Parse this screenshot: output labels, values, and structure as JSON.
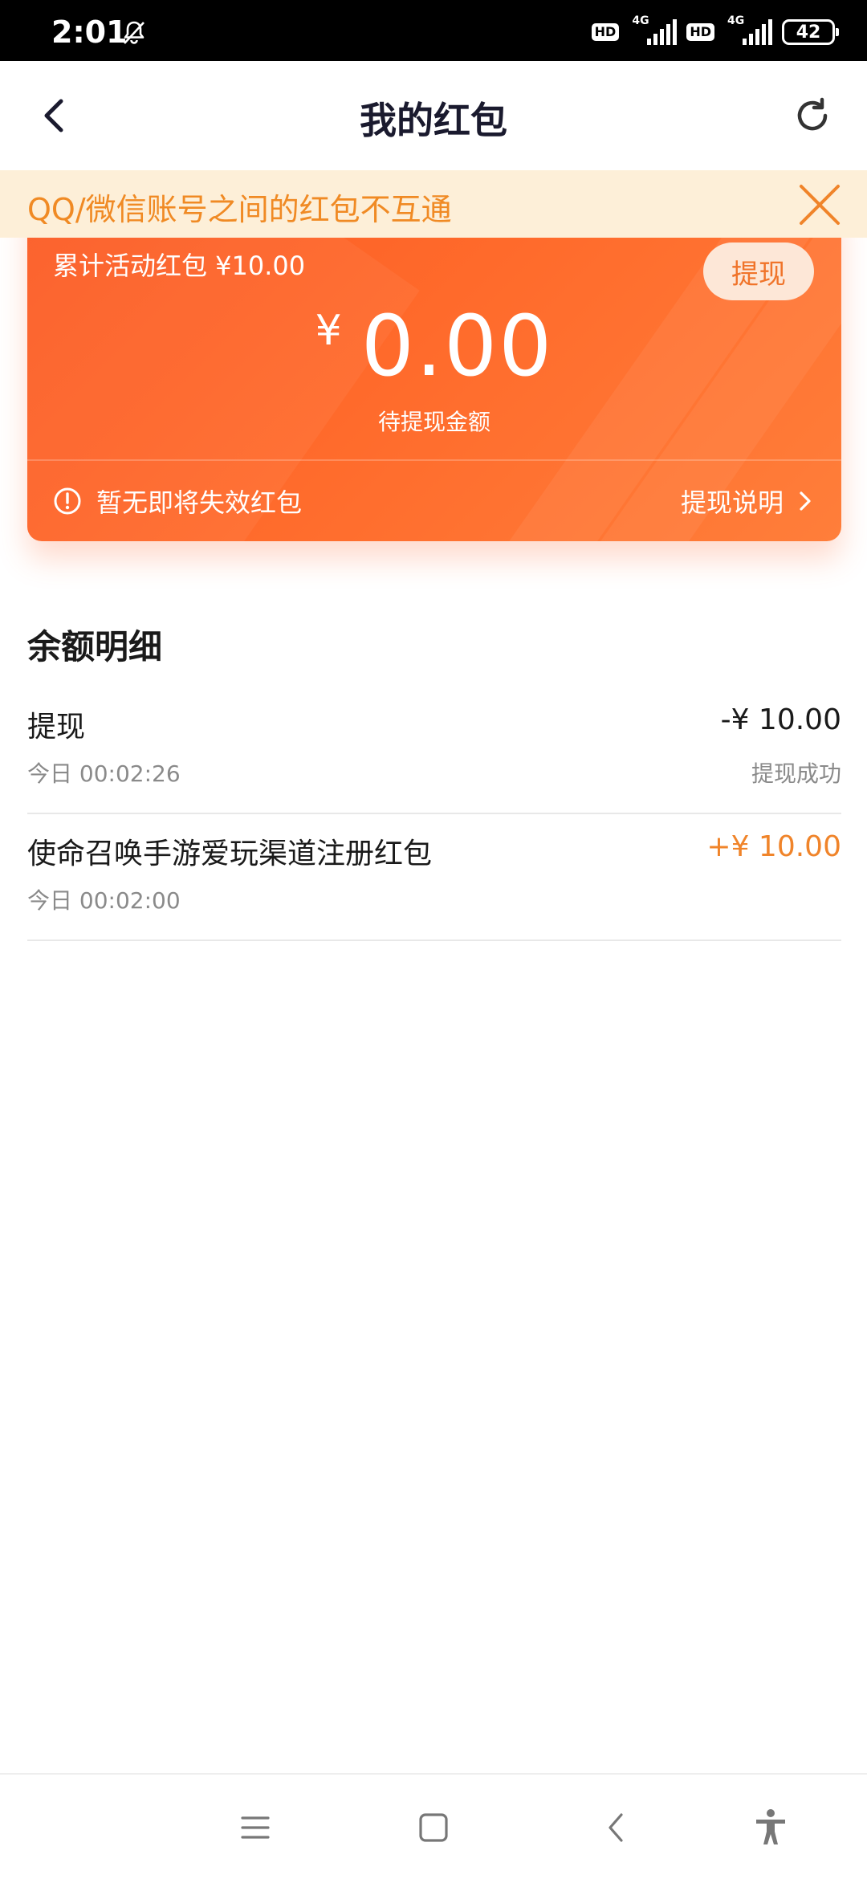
{
  "status_bar": {
    "time": "2:01",
    "signal_1": {
      "badge": "HD",
      "network": "4G"
    },
    "signal_2": {
      "badge": "HD",
      "network": "4G"
    },
    "battery": "42"
  },
  "header": {
    "title": "我的红包"
  },
  "notice": {
    "text": "QQ/微信账号之间的红包不互通"
  },
  "card": {
    "cumulative_label": "累计活动红包 ¥10.00",
    "withdraw_button": "提现",
    "currency_symbol": "¥",
    "amount": "0.00",
    "amount_caption": "待提现金额",
    "expire_text": "暂无即将失效红包",
    "explain_link": "提现说明"
  },
  "balance_detail": {
    "title": "余额明细",
    "records": [
      {
        "name": "提现",
        "time": "今日 00:02:26",
        "amount": "-¥ 10.00",
        "status": "提现成功"
      },
      {
        "name": "使命召唤手游爱玩渠道注册红包",
        "time": "今日 00:02:00",
        "amount": "+¥ 10.00",
        "status": ""
      }
    ]
  },
  "colors": {
    "accent_orange": "#f0842a",
    "card_gradient_start": "#fb5a23",
    "card_gradient_end": "#ff7e3a",
    "notice_background": "#fdefd8"
  },
  "icons": {
    "back": "back-arrow-icon",
    "refresh": "refresh-icon",
    "close": "close-icon",
    "alert": "alert-circle-icon",
    "chevron": "chevron-right-icon",
    "nav_menu": "menu-icon",
    "nav_home": "home-icon",
    "nav_back": "back-icon",
    "nav_accessibility": "accessibility-icon"
  }
}
